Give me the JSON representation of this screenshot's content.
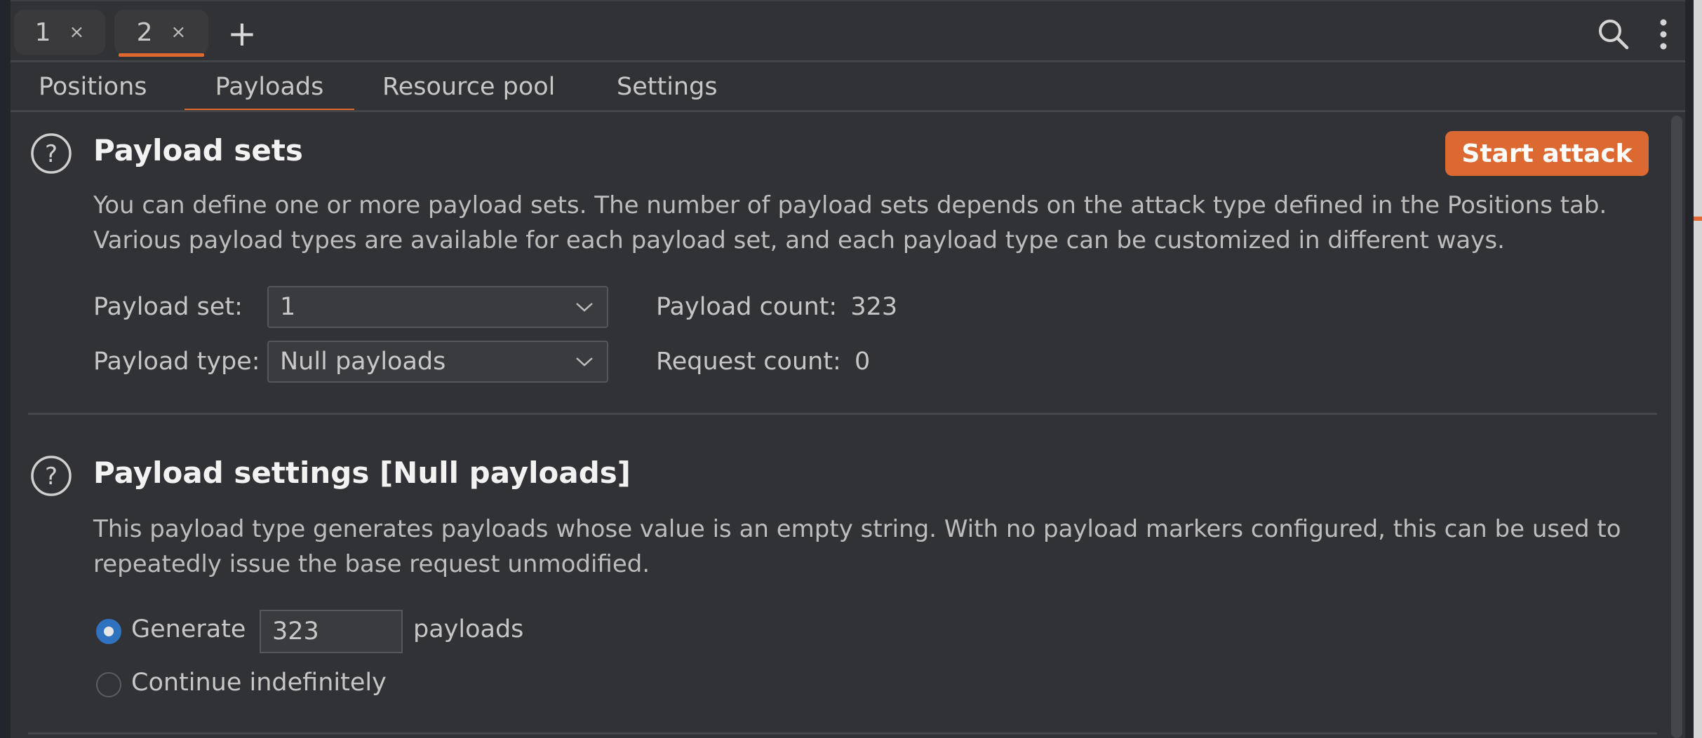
{
  "window_tabs": [
    {
      "label": "1",
      "close": "×",
      "active": false
    },
    {
      "label": "2",
      "close": "×",
      "active": true
    }
  ],
  "add_tab_label": "+",
  "toolbar_icons": [
    "search-icon",
    "more-options-icon"
  ],
  "subtabs": [
    {
      "label": "Positions",
      "active": false
    },
    {
      "label": "Payloads",
      "active": true
    },
    {
      "label": "Resource pool",
      "active": false
    },
    {
      "label": "Settings",
      "active": false
    }
  ],
  "payload_sets": {
    "title": "Payload sets",
    "help_icon": "question-circle-icon",
    "start_attack_label": "Start attack",
    "description_lines": [
      "You can define one or more payload sets. The number of payload sets depends on the attack type defined in the Positions tab.",
      "Various payload types are available for each payload set, and each payload type can be customized in different ways."
    ],
    "payload_set_label": "Payload set:",
    "payload_set_value": "1",
    "payload_type_label": "Payload type:",
    "payload_type_value": "Null payloads",
    "payload_count_label": "Payload count:",
    "payload_count_value": "323",
    "request_count_label": "Request count:",
    "request_count_value": "0"
  },
  "payload_settings": {
    "title": "Payload settings [Null payloads]",
    "help_icon": "question-circle-icon",
    "description_lines": [
      "This payload type generates payloads whose value is an empty string. With no payload markers configured, this can be used to",
      "repeatedly issue the base request unmodified."
    ],
    "generate_label": "Generate",
    "generate_value": "323",
    "generate_suffix": "payloads",
    "generate_selected": true,
    "continue_label": "Continue indefinitely",
    "continue_selected": false
  },
  "colors": {
    "accent": "#e0672e",
    "button": "#dc6832",
    "background": "#313235",
    "radio_selected": "#2f72c0"
  }
}
